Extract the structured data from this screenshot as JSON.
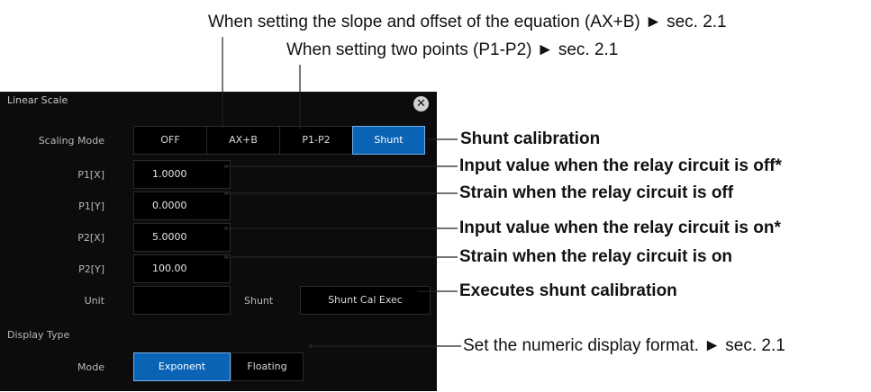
{
  "annotations": {
    "top_line1": "When setting the slope and offset of the equation (AX+B) ► sec. 2.1",
    "top_line2": "When setting two points (P1-P2) ► sec. 2.1",
    "shunt_calibration": "Shunt calibration",
    "p1x_note": "Input value when the relay circuit is off*",
    "p1y_note": "Strain when the relay circuit is off",
    "p2x_note": "Input value when the relay circuit is on*",
    "p2y_note": "Strain when the relay circuit is on",
    "exec_note": "Executes shunt calibration",
    "display_note": "Set the numeric display format. ► sec. 2.1"
  },
  "dialog": {
    "title": "Linear Scale",
    "close_icon": "close-icon",
    "scaling_mode": {
      "label": "Scaling Mode",
      "options": [
        "OFF",
        "AX+B",
        "P1-P2",
        "Shunt"
      ],
      "selected": "Shunt"
    },
    "fields": {
      "p1x": {
        "label": "P1[X]",
        "value": "1.0000"
      },
      "p1y": {
        "label": "P1[Y]",
        "value": "0.0000"
      },
      "p2x": {
        "label": "P2[X]",
        "value": "5.0000"
      },
      "p2y": {
        "label": "P2[Y]",
        "value": "100.00"
      },
      "unit": {
        "label": "Unit",
        "value": ""
      }
    },
    "shunt_label": "Shunt",
    "shunt_exec_button": "Shunt Cal Exec",
    "display_type": {
      "label": "Display Type",
      "mode_label": "Mode",
      "options": [
        "Exponent",
        "Floating"
      ],
      "selected": "Exponent"
    }
  },
  "colors": {
    "panel_bg": "#0c0c0c",
    "selected_blue": "#0a63b5"
  }
}
